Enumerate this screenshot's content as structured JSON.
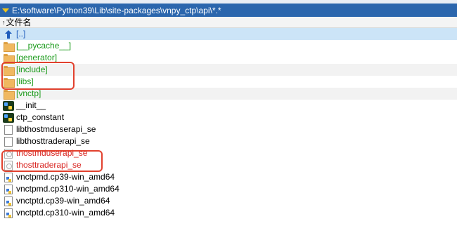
{
  "path_bar": {
    "path": "E:\\software\\Python39\\Lib\\site-packages\\vnpy_ctp\\api\\*.*"
  },
  "header": {
    "sort_arrow": "↑",
    "column_name": "文件名"
  },
  "files": [
    {
      "name": "[..]",
      "icon": "up-arrow-icon",
      "color": "#1f5cbc",
      "selected": true
    },
    {
      "name": "[__pycache__]",
      "icon": "folder-icon",
      "color": "#1b9b1b"
    },
    {
      "name": "[generator]",
      "icon": "folder-icon",
      "color": "#1b9b1b"
    },
    {
      "name": "[include]",
      "icon": "folder-icon",
      "color": "#1b9b1b"
    },
    {
      "name": "[libs]",
      "icon": "folder-icon",
      "color": "#1b9b1b"
    },
    {
      "name": "[vnctp]",
      "icon": "folder-icon",
      "color": "#1b9b1b"
    },
    {
      "name": "__init__",
      "icon": "python-file-icon",
      "color": "#000000"
    },
    {
      "name": "ctp_constant",
      "icon": "python-file-icon",
      "color": "#000000"
    },
    {
      "name": "libthostmduserapi_se",
      "icon": "file-icon",
      "color": "#000000"
    },
    {
      "name": "libthosttraderapi_se",
      "icon": "file-icon",
      "color": "#000000"
    },
    {
      "name": "thostmduserapi_se",
      "icon": "dll-icon",
      "color": "#d8231f"
    },
    {
      "name": "thosttraderapi_se",
      "icon": "dll-icon",
      "color": "#d8231f"
    },
    {
      "name": "vnctpmd.cp39-win_amd64",
      "icon": "pyd-file-icon",
      "color": "#000000"
    },
    {
      "name": "vnctpmd.cp310-win_amd64",
      "icon": "pyd-file-icon",
      "color": "#000000"
    },
    {
      "name": "vnctptd.cp39-win_amd64",
      "icon": "pyd-file-icon",
      "color": "#000000"
    },
    {
      "name": "vnctptd.cp310-win_amd64",
      "icon": "pyd-file-icon",
      "color": "#000000"
    }
  ],
  "annotation_color": "#e2412e"
}
